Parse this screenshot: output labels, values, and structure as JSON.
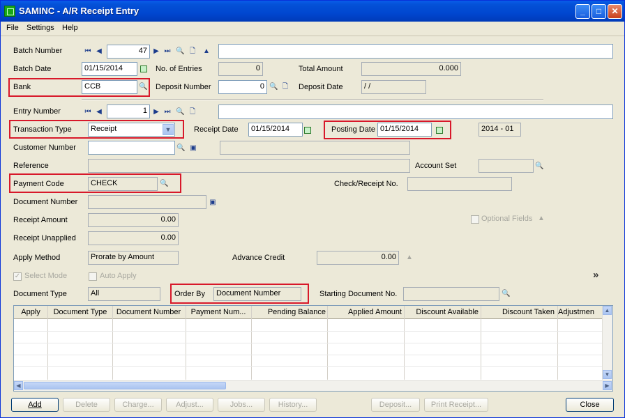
{
  "window": {
    "title": "SAMINC - A/R Receipt Entry"
  },
  "menu": {
    "file": "File",
    "settings": "Settings",
    "help": "Help"
  },
  "batch": {
    "number_label": "Batch Number",
    "number": "47",
    "description": "",
    "date_label": "Batch Date",
    "date": "01/15/2014",
    "entries_label": "No. of Entries",
    "entries": "0",
    "total_label": "Total Amount",
    "total": "0.000",
    "bank_label": "Bank",
    "bank": "CCB",
    "deposit_number_label": "Deposit Number",
    "deposit_number": "0",
    "deposit_date_label": "Deposit Date",
    "deposit_date": "/  /"
  },
  "entry": {
    "number_label": "Entry Number",
    "number": "1",
    "description": "",
    "transaction_type_label": "Transaction Type",
    "transaction_type": "Receipt",
    "receipt_date_label": "Receipt Date",
    "receipt_date": "01/15/2014",
    "posting_date_label": "Posting Date",
    "posting_date": "01/15/2014",
    "period": "2014 - 01",
    "customer_label": "Customer Number",
    "customer": "",
    "customer_name": "",
    "reference_label": "Reference",
    "reference": "",
    "account_set_label": "Account Set",
    "account_set": "",
    "payment_code_label": "Payment Code",
    "payment_code": "CHECK",
    "check_label": "Check/Receipt No.",
    "check": "",
    "document_number_label": "Document Number",
    "document_number": "",
    "optional_fields_label": "Optional Fields",
    "receipt_amount_label": "Receipt Amount",
    "receipt_amount": "0.00",
    "receipt_unapplied_label": "Receipt Unapplied",
    "receipt_unapplied": "0.00",
    "apply_method_label": "Apply Method",
    "apply_method": "Prorate by Amount",
    "advance_credit_label": "Advance Credit",
    "advance_credit": "0.00",
    "select_mode_label": "Select Mode",
    "auto_apply_label": "Auto Apply",
    "document_type_label": "Document Type",
    "document_type": "All",
    "order_by_label": "Order By",
    "order_by": "Document Number",
    "starting_doc_label": "Starting Document No.",
    "starting_doc": "",
    "more_glyph": "»"
  },
  "grid": {
    "columns": [
      "Apply",
      "Document Type",
      "Document Number",
      "Payment Num...",
      "Pending Balance",
      "Applied Amount",
      "Discount Available",
      "Discount Taken",
      "Adjustmen"
    ]
  },
  "buttons": {
    "add": "Add",
    "delete": "Delete",
    "charge": "Charge...",
    "adjust": "Adjust...",
    "jobs": "Jobs...",
    "history": "History...",
    "deposit": "Deposit...",
    "print_receipt": "Print Receipt...",
    "close": "Close"
  },
  "highlight_color": "#d8182a",
  "icons": [
    "first-icon",
    "previous-icon",
    "next-icon",
    "last-icon",
    "finder-icon",
    "new-document-icon",
    "calendar-icon",
    "zoom-icon",
    "scroll-arrow-icon"
  ]
}
